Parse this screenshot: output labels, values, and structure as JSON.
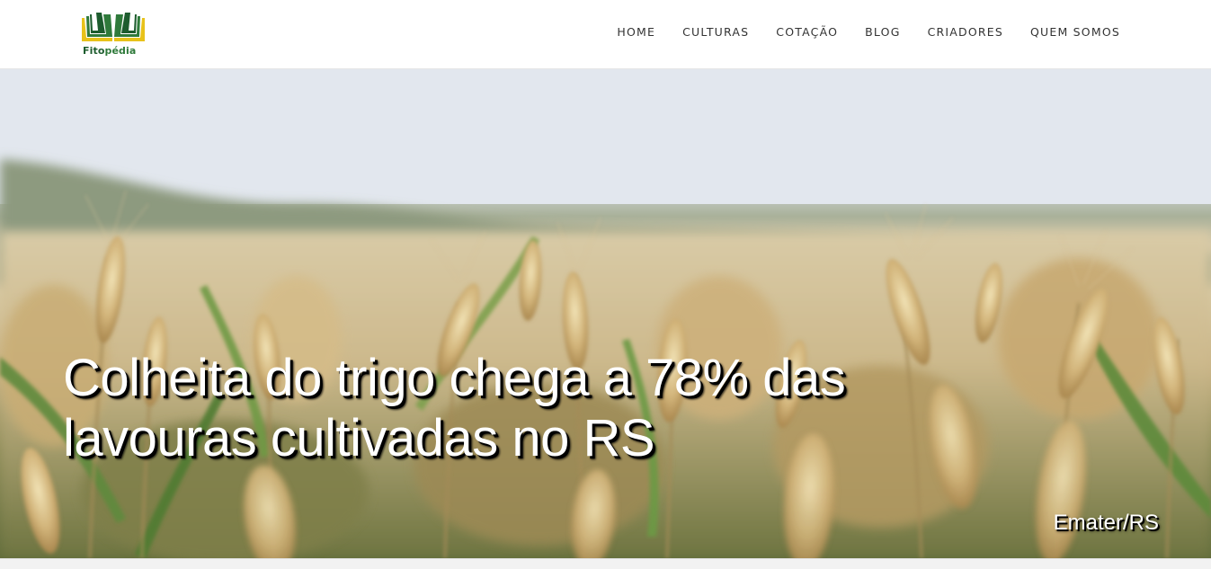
{
  "brand": {
    "name_part1": "Fito",
    "name_part2": "pédia",
    "logo_icon": "open-books-logo-icon",
    "colors": {
      "yellow": "#e8c21a",
      "green": "#2f7a3b",
      "dark_green": "#1d5c2e"
    }
  },
  "nav": {
    "items": [
      {
        "label": "HOME"
      },
      {
        "label": "CULTURAS"
      },
      {
        "label": "COTAÇÃO"
      },
      {
        "label": "BLOG"
      },
      {
        "label": "CRIADORES"
      },
      {
        "label": "QUEM SOMOS"
      }
    ]
  },
  "hero": {
    "title": "Colheita do trigo chega a 78% das lavouras cultivadas no RS",
    "credit": "Emater/RS",
    "image_subject": "wheat-field-photo"
  }
}
